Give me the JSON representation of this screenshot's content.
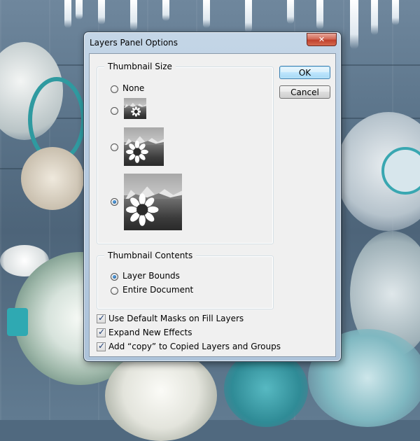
{
  "dialog": {
    "title": "Layers Panel Options",
    "ok_label": "OK",
    "cancel_label": "Cancel",
    "close_glyph": "✕"
  },
  "thumbnail_size": {
    "group_title": "Thumbnail Size",
    "options": [
      {
        "label": "None",
        "selected": false
      },
      {
        "label": "",
        "selected": false,
        "size": "small"
      },
      {
        "label": "",
        "selected": false,
        "size": "medium"
      },
      {
        "label": "",
        "selected": true,
        "size": "large"
      }
    ]
  },
  "thumbnail_contents": {
    "group_title": "Thumbnail Contents",
    "options": [
      {
        "label": "Layer Bounds",
        "selected": true
      },
      {
        "label": "Entire Document",
        "selected": false
      }
    ]
  },
  "checkboxes": [
    {
      "label": "Use Default Masks on Fill Layers",
      "checked": true
    },
    {
      "label": "Expand New Effects",
      "checked": true
    },
    {
      "label": "Add “copy” to Copied Layers and Groups",
      "checked": true
    }
  ],
  "colors": {
    "accent_blue": "#3c7fb1",
    "close_red": "#c0412c",
    "frame_blue": "#b7cbe0"
  }
}
